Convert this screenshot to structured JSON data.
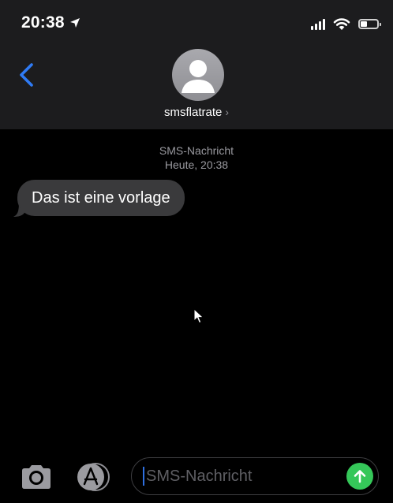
{
  "status_bar": {
    "time": "20:38",
    "battery_level_fraction": 0.4
  },
  "nav": {
    "back_icon": "chevron-left-icon",
    "contact": {
      "name": "smsflatrate",
      "chevron": "›"
    }
  },
  "conversation": {
    "meta": {
      "type": "SMS-Nachricht",
      "timestamp": "Heute, 20:38"
    },
    "messages": [
      {
        "direction": "incoming",
        "text": "Das ist eine vorlage"
      }
    ]
  },
  "compose": {
    "placeholder": "SMS-Nachricht",
    "camera_icon": "camera-icon",
    "apps_icon": "app-store-icon",
    "send_icon": "send-arrow-icon"
  },
  "colors": {
    "header_bg": "#1c1c1e",
    "bubble_incoming": "#3a3a3c",
    "accent_blue": "#2f6fe0",
    "send_green": "#35c759",
    "meta_text": "#9a9aa0"
  }
}
